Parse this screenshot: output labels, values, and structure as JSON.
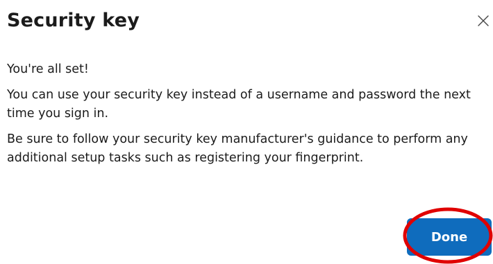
{
  "dialog": {
    "title": "Security key",
    "close_icon": "close-icon",
    "paragraphs": [
      "You're all set!",
      "You can use your security key instead of a username and password the next time you sign in.",
      "Be sure to follow your security key manufacturer's guidance to perform any additional setup tasks such as registering your fingerprint."
    ],
    "done_label": "Done"
  },
  "colors": {
    "primary_button": "#0f6cbd",
    "annotation_ring": "#e00000",
    "text": "#1b1b1b"
  }
}
